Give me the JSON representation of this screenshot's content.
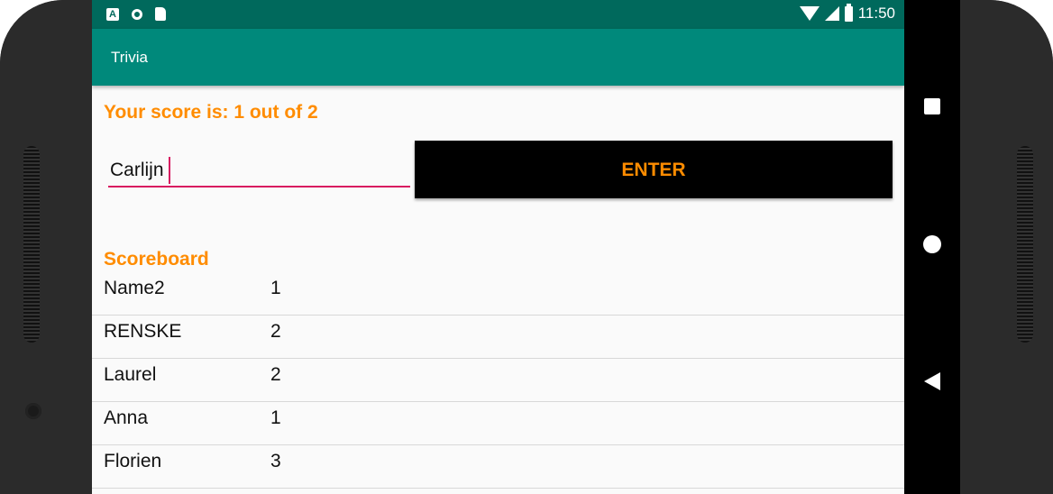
{
  "status_bar": {
    "time": "11:50",
    "left_icons": [
      "a-icon",
      "circle-icon",
      "sd-card-icon"
    ],
    "right_icons": [
      "wifi-icon",
      "cell-signal-icon",
      "battery-icon"
    ]
  },
  "app_bar": {
    "title": "Trivia"
  },
  "score_text": "Your score is: 1 out of 2",
  "name_input": {
    "value": "Carlijn"
  },
  "enter_button": {
    "label": "ENTER"
  },
  "scoreboard": {
    "title": "Scoreboard",
    "rows": [
      {
        "name": "Name2",
        "score": "1"
      },
      {
        "name": "RENSKE",
        "score": "2"
      },
      {
        "name": "Laurel",
        "score": "2"
      },
      {
        "name": "Anna",
        "score": "1"
      },
      {
        "name": "Florien",
        "score": "3"
      }
    ]
  },
  "colors": {
    "status_bar": "#00695c",
    "app_bar": "#00897b",
    "accent_orange": "#ff8c00",
    "input_underline": "#d81b60",
    "button_bg": "#000000"
  },
  "nav_bar": {
    "icons": [
      "recents-square-icon",
      "home-circle-icon",
      "back-triangle-icon"
    ]
  }
}
